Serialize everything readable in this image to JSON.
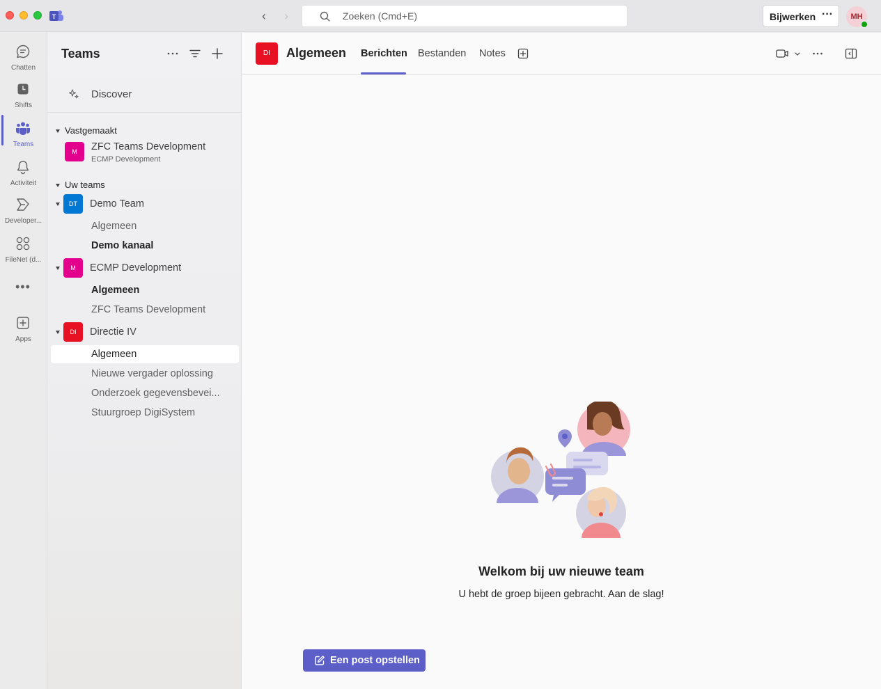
{
  "titlebar": {
    "search_placeholder": "Zoeken (Cmd+E)",
    "update_label": "Bijwerken",
    "more": "···",
    "avatar_initials": "MH",
    "presence_color": "#13a10e"
  },
  "rail": {
    "items": [
      {
        "label": "Chatten",
        "icon": "chat-icon"
      },
      {
        "label": "Shifts",
        "icon": "shifts-icon"
      },
      {
        "label": "Teams",
        "icon": "teams-icon",
        "active": true
      },
      {
        "label": "Activiteit",
        "icon": "bell-icon"
      },
      {
        "label": "Developer...",
        "icon": "developer-portal-icon"
      },
      {
        "label": "FileNet (d...",
        "icon": "filenet-icon"
      },
      {
        "label": "Apps",
        "icon": "apps-add-icon"
      }
    ],
    "more": "•••"
  },
  "pane": {
    "title": "Teams",
    "discover": "Discover",
    "pinned_section": "Vastgemaakt",
    "pinned": {
      "initials": "M",
      "name": "ZFC Teams Development",
      "team": "ECMP Development",
      "color": "#e3008c"
    },
    "teams_section": "Uw teams",
    "teams": [
      {
        "initials": "DT",
        "name": "Demo Team",
        "color": "#0078d4",
        "channels": [
          {
            "name": "Algemeen",
            "bold": false
          },
          {
            "name": "Demo kanaal",
            "bold": true
          }
        ]
      },
      {
        "initials": "M",
        "name": "ECMP Development",
        "color": "#e3008c",
        "channels": [
          {
            "name": "Algemeen",
            "bold": true
          },
          {
            "name": "ZFC Teams Development",
            "bold": false
          }
        ]
      },
      {
        "initials": "DI",
        "name": "Directie IV",
        "color": "#e81123",
        "channels": [
          {
            "name": "Algemeen",
            "bold": false,
            "selected": true
          },
          {
            "name": "Nieuwe vergader oplossing",
            "bold": false
          },
          {
            "name": "Onderzoek gegevensbevei...",
            "bold": false
          },
          {
            "name": "Stuurgroep DigiSystem",
            "bold": false
          }
        ]
      }
    ]
  },
  "main": {
    "channel_initials": "DI",
    "channel_title": "Algemeen",
    "tabs": [
      "Berichten",
      "Bestanden",
      "Notes"
    ],
    "active_tab": "Berichten",
    "welcome_title": "Welkom bij uw nieuwe team",
    "welcome_sub": "U hebt de groep bijeen gebracht. Aan de slag!",
    "post_button": "Een post opstellen",
    "accent": "#5b5fc7"
  }
}
